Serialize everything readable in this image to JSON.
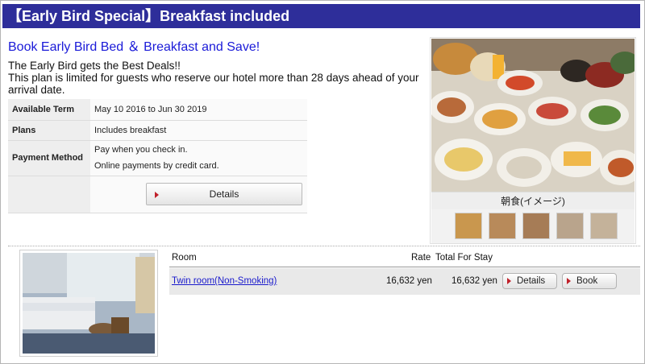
{
  "plan": {
    "title": "【Early Bird Special】Breakfast included",
    "headline": "Book Early Bird Bed ＆ Breakfast and Save!",
    "intro_line1": "The Early Bird gets the Best Deals!!",
    "intro_line2": "This plan is limited for guests who reserve our hotel more than 28 days ahead of your arrival date.",
    "available_term_label": "Available Term",
    "available_term_value": "May 10 2016 to Jun 30 2019",
    "plans_label": "Plans",
    "plans_value": "Includes breakfast",
    "payment_label": "Payment Method",
    "payment_line1": "Pay when you check in.",
    "payment_line2": "Online payments by credit card.",
    "details_button": "Details"
  },
  "photo": {
    "caption": "朝食(イメージ)",
    "thumbnails": [
      "breakfast-thumb-1",
      "breakfast-thumb-2",
      "breakfast-thumb-3",
      "breakfast-thumb-4",
      "breakfast-thumb-5"
    ]
  },
  "rooms": {
    "headers": {
      "room": "Room",
      "rate": "Rate",
      "total": "Total For Stay"
    },
    "items": [
      {
        "name": "Twin room(Non-Smoking)",
        "rate": "16,632 yen",
        "total": "16,632 yen",
        "details_button": "Details",
        "book_button": "Book"
      }
    ]
  },
  "colors": {
    "title_bar": "#2e2e9a",
    "headline": "#1a1ad8",
    "link": "#1a1acc",
    "button_arrow": "#c0202a"
  }
}
